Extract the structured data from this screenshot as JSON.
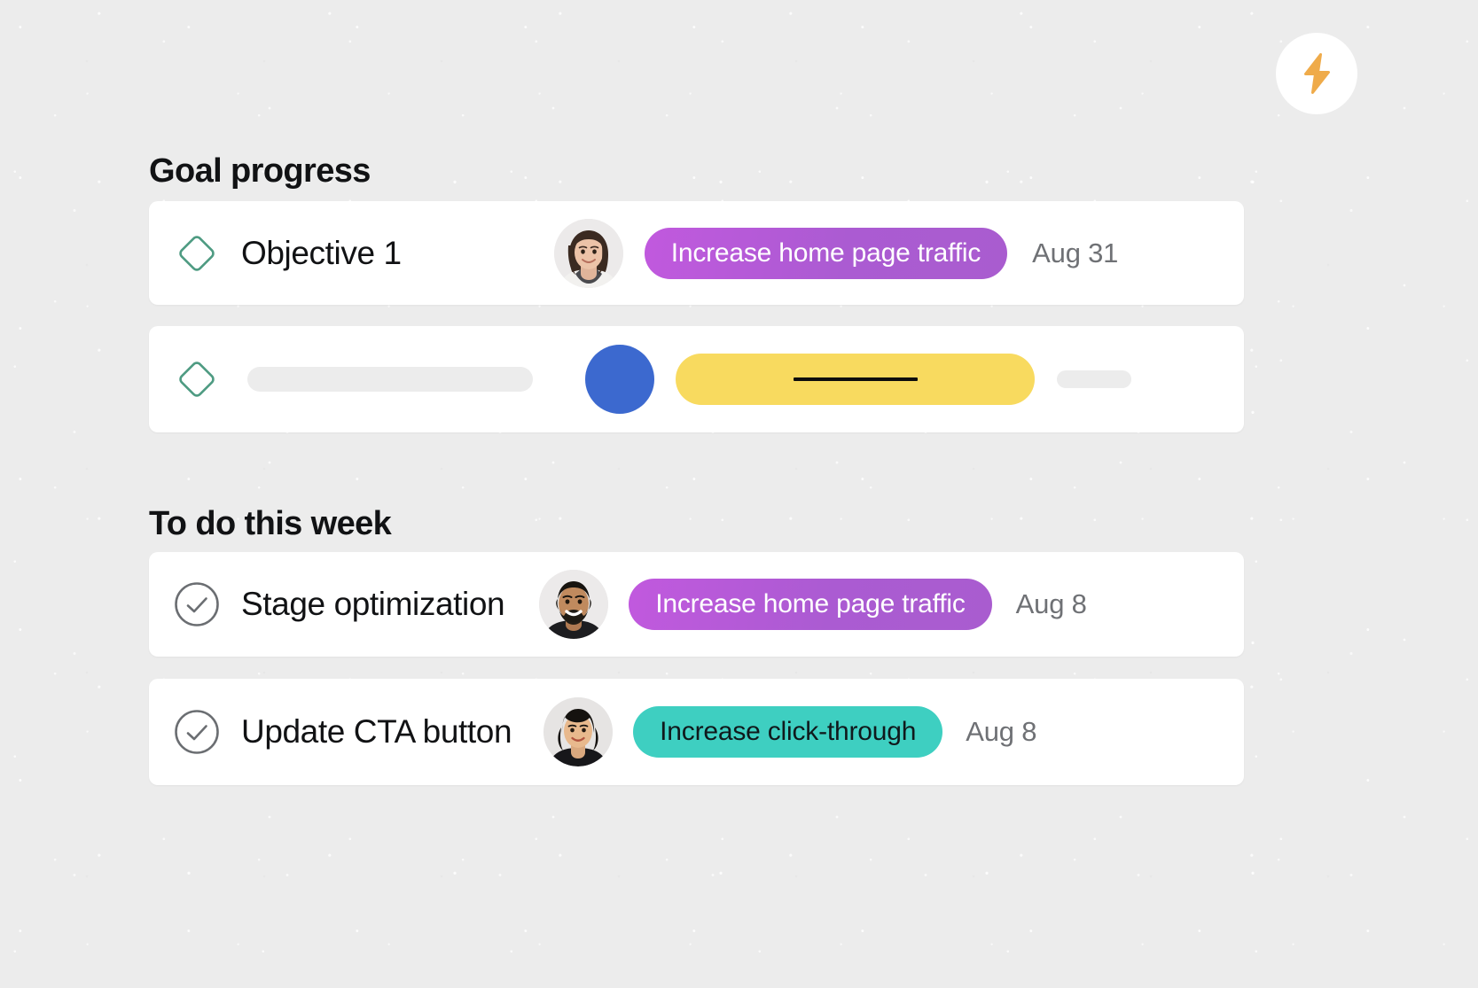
{
  "badge": {
    "icon": "lightning-bolt-icon",
    "color": "#efab4a",
    "background": "#ffffff"
  },
  "sections": [
    {
      "id": "goal-progress",
      "title": "Goal progress",
      "rows": [
        {
          "id": "objective-1",
          "status_icon": "diamond-outline-icon",
          "status_icon_color": "#4e9b82",
          "title": "Objective 1",
          "avatar": "avatar-photo-woman",
          "pill": {
            "label": "Increase home page traffic",
            "color": "#b45bd4",
            "text_color": "#ffffff"
          },
          "date": "Aug 31"
        },
        {
          "id": "objective-placeholder",
          "status_icon": "diamond-outline-icon",
          "status_icon_color": "#4e9b82",
          "title": "",
          "avatar": "avatar-solid-blue",
          "avatar_color": "#3c69cf",
          "pill": {
            "label": "",
            "color": "#f8da5f",
            "redacted": true
          },
          "date": "",
          "placeholder": true
        }
      ]
    },
    {
      "id": "to-do-this-week",
      "title": "To do this week",
      "rows": [
        {
          "id": "stage-optimization",
          "status_icon": "check-circle-icon",
          "status_icon_color": "#6b6e72",
          "title": "Stage optimization",
          "avatar": "avatar-photo-man",
          "pill": {
            "label": "Increase home page traffic",
            "color": "#b45bd4",
            "text_color": "#ffffff"
          },
          "date": "Aug 8"
        },
        {
          "id": "update-cta-button",
          "status_icon": "check-circle-icon",
          "status_icon_color": "#6b6e72",
          "title": "Update CTA button",
          "avatar": "avatar-photo-person",
          "pill": {
            "label": "Increase click-through",
            "color": "#3ecfc1",
            "text_color": "#10191c"
          },
          "date": "Aug 8"
        }
      ]
    }
  ],
  "colors": {
    "background": "#ececec",
    "card": "#ffffff",
    "text_primary": "#111214",
    "text_muted": "#6f7175",
    "accent_purple": "#b45bd4",
    "accent_teal": "#3ecfc1",
    "accent_yellow": "#f8da5f",
    "accent_blue": "#3c69cf",
    "accent_green": "#4e9b82",
    "accent_orange": "#efab4a",
    "skeleton": "#ececec"
  }
}
